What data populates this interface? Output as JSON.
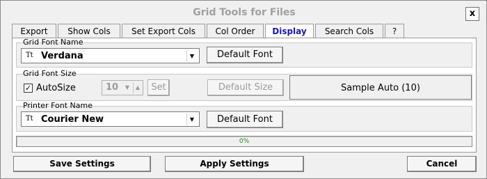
{
  "window": {
    "title": "Grid Tools for Files",
    "close_label": "x"
  },
  "tabs": [
    {
      "label": "Export"
    },
    {
      "label": "Show Cols"
    },
    {
      "label": "Set Export Cols"
    },
    {
      "label": "Col Order"
    },
    {
      "label": "Display",
      "active": true
    },
    {
      "label": "Search Cols"
    },
    {
      "label": "?"
    }
  ],
  "grid_font": {
    "group_label": "Grid Font Name",
    "selected": "Verdana",
    "default_button": "Default Font"
  },
  "grid_font_size": {
    "group_label": "Grid Font Size",
    "autosize_label": "AutoSize",
    "autosize_checked": true,
    "size_value": "10",
    "set_button": "Set",
    "default_size_button": "Default Size",
    "sample_text": "Sample Auto (10)"
  },
  "printer_font": {
    "group_label": "Printer Font Name",
    "selected": "Courier New",
    "default_button": "Default Font"
  },
  "progress": {
    "value": 0,
    "label": "0%"
  },
  "footer": {
    "save_label": "Save Settings",
    "apply_label": "Apply Settings",
    "cancel_label": "Cancel"
  },
  "icons": {
    "font_icon": "truetype-font-icon",
    "dropdown": "chevron-down-icon"
  }
}
